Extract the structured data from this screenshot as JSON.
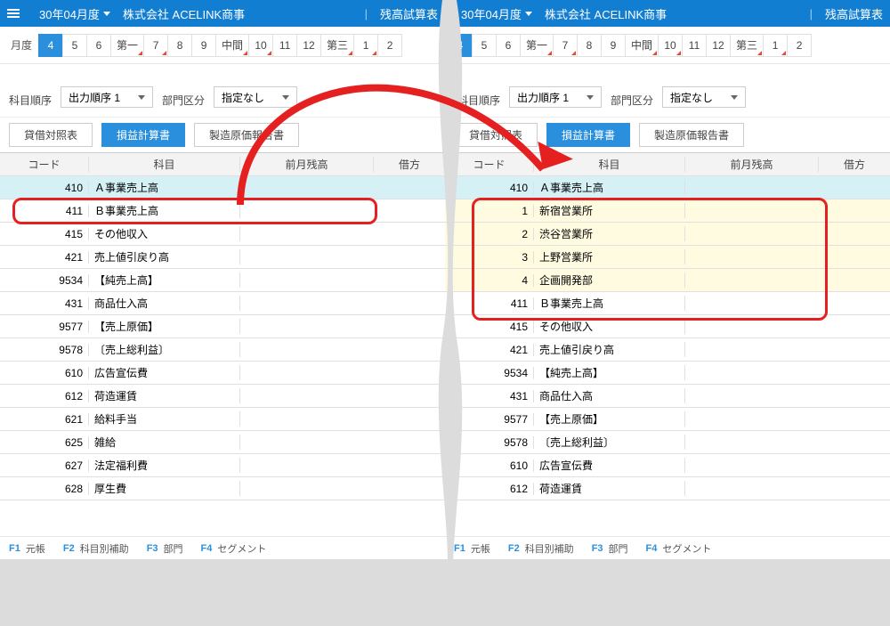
{
  "topbar": {
    "period": "30年04月度",
    "company": "株式会社 ACELINK商事",
    "title": "残高試算表"
  },
  "monthbar": {
    "label": "月度",
    "active": "4",
    "items": [
      "4",
      "5",
      "6",
      "第一",
      "7",
      "8",
      "9",
      "中間",
      "10",
      "11",
      "12",
      "第三",
      "1",
      "2"
    ]
  },
  "filters": {
    "order_label": "科目順序",
    "order_value": "出力順序 1",
    "dept_label": "部門区分",
    "dept_value": "指定なし"
  },
  "report_tabs": {
    "bs": "貸借対照表",
    "pl": "損益計算書",
    "mfg": "製造原価報告書"
  },
  "head": {
    "code": "コード",
    "name": "科目",
    "prev": "前月残高",
    "dr": "借方"
  },
  "left_rows": [
    {
      "code": "410",
      "name": "Ａ事業売上高",
      "hl": true
    },
    {
      "code": "411",
      "name": "Ｂ事業売上高"
    },
    {
      "code": "415",
      "name": "その他収入"
    },
    {
      "code": "421",
      "name": "売上値引戻り高"
    },
    {
      "code": "9534",
      "name": "【純売上高】"
    },
    {
      "code": "431",
      "name": "商品仕入高"
    },
    {
      "code": "9577",
      "name": "【売上原価】"
    },
    {
      "code": "9578",
      "name": "〔売上総利益〕",
      "dim": true
    },
    {
      "code": "610",
      "name": "広告宣伝費"
    },
    {
      "code": "612",
      "name": "荷造運賃"
    },
    {
      "code": "621",
      "name": "給料手当"
    },
    {
      "code": "625",
      "name": "雑給"
    },
    {
      "code": "627",
      "name": "法定福利費"
    },
    {
      "code": "628",
      "name": "厚生費"
    }
  ],
  "right_rows": [
    {
      "code": "410",
      "name": "Ａ事業売上高",
      "hl": true
    },
    {
      "code": "1",
      "name": "新宿営業所",
      "sub": true
    },
    {
      "code": "2",
      "name": "渋谷営業所",
      "sub": true
    },
    {
      "code": "3",
      "name": "上野営業所",
      "sub": true
    },
    {
      "code": "4",
      "name": "企画開発部",
      "sub": true
    },
    {
      "code": "411",
      "name": "Ｂ事業売上高"
    },
    {
      "code": "415",
      "name": "その他収入"
    },
    {
      "code": "421",
      "name": "売上値引戻り高"
    },
    {
      "code": "9534",
      "name": "【純売上高】"
    },
    {
      "code": "431",
      "name": "商品仕入高"
    },
    {
      "code": "9577",
      "name": "【売上原価】"
    },
    {
      "code": "9578",
      "name": "〔売上総利益〕",
      "dim": true
    },
    {
      "code": "610",
      "name": "広告宣伝費"
    },
    {
      "code": "612",
      "name": "荷造運賃"
    }
  ],
  "fkeys": [
    {
      "fn": "F1",
      "label": "元帳"
    },
    {
      "fn": "F2",
      "label": "科目別補助"
    },
    {
      "fn": "F3",
      "label": "部門"
    },
    {
      "fn": "F4",
      "label": "セグメント"
    }
  ]
}
